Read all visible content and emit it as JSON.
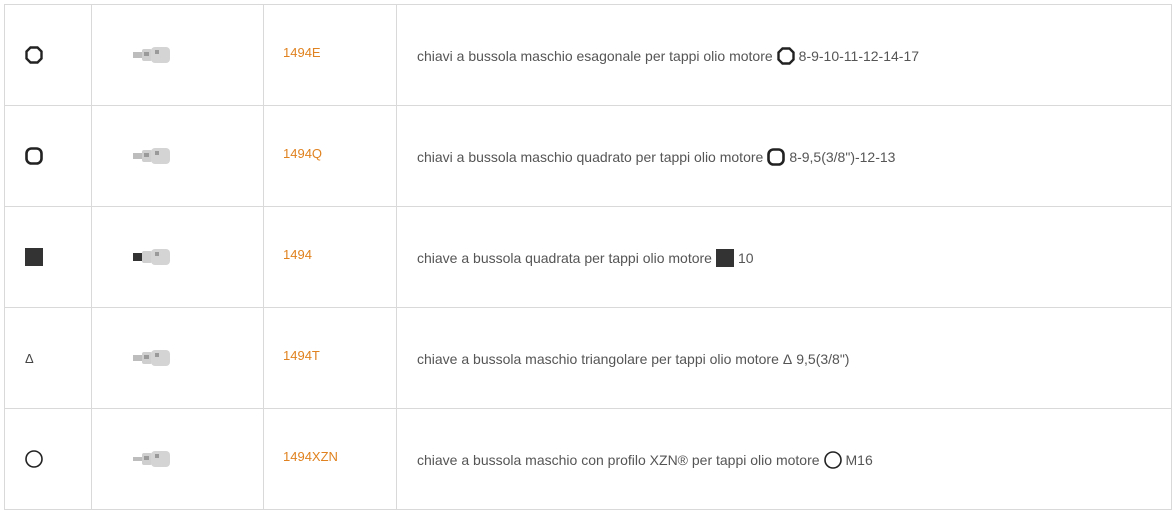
{
  "rows": [
    {
      "profile_icon": "hexagon-outline-icon",
      "code": "1494E",
      "description": "chiavi a bussola maschio esagonale per tappi olio motore",
      "sizes": "8-9-10-11-12-14-17"
    },
    {
      "profile_icon": "square-rounded-outline-icon",
      "code": "1494Q",
      "description": "chiavi a bussola maschio quadrato per tappi olio motore",
      "sizes": "8-9,5(3/8\")-12-13"
    },
    {
      "profile_icon": "square-filled-icon",
      "code": "1494",
      "description": "chiave a bussola quadrata per tappi olio motore",
      "sizes": "10"
    },
    {
      "profile_icon": "triangle-symbol",
      "profile_text": "Δ",
      "code": "1494T",
      "description": "chiave a bussola maschio triangolare per tappi olio motore",
      "sizes": "9,5(3/8\")",
      "inline_symbol": "Δ"
    },
    {
      "profile_icon": "circle-outline-icon",
      "code": "1494XZN",
      "description": "chiave a bussola maschio con profilo XZN® per tappi olio motore",
      "sizes": "M16"
    }
  ],
  "colors": {
    "code": "#e0821f",
    "text": "#555555",
    "border": "#d9d9d9"
  }
}
